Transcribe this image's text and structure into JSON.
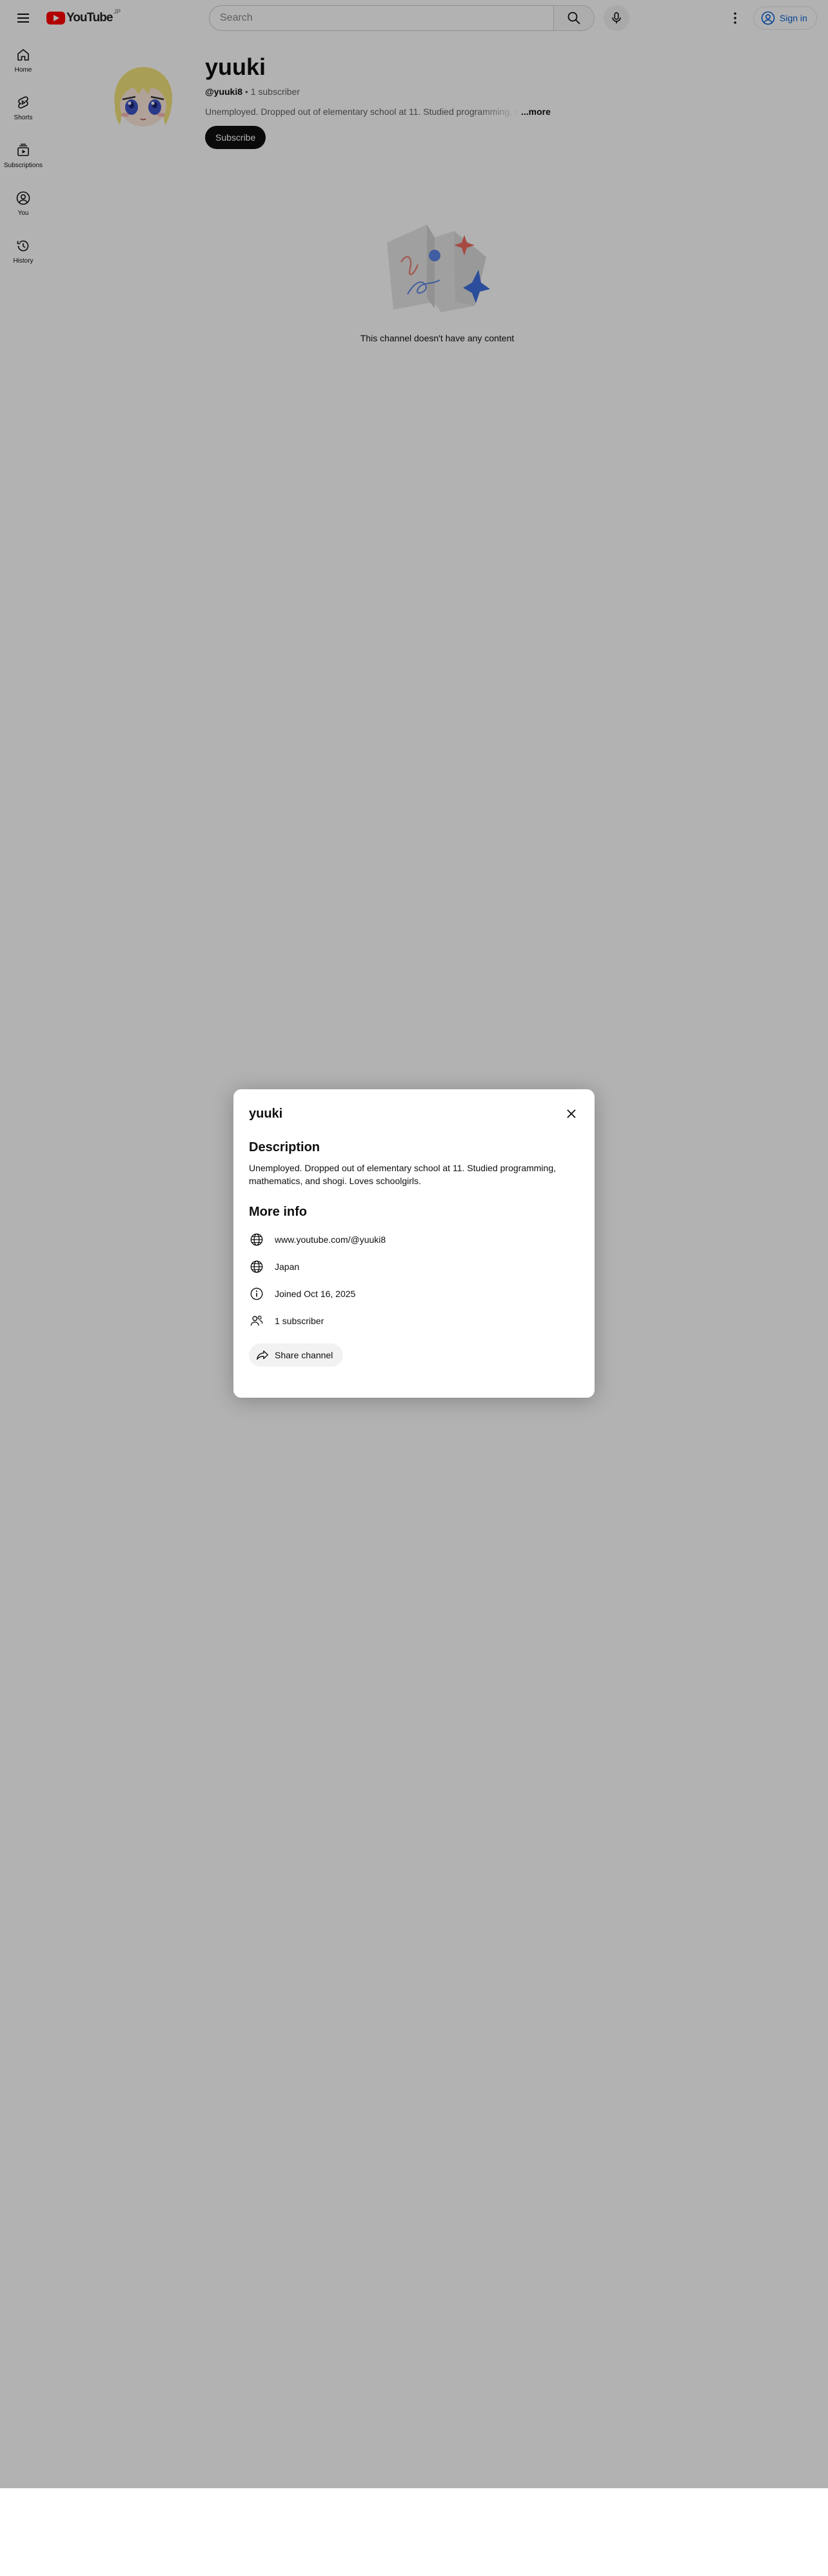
{
  "masthead": {
    "logo_text": "YouTube",
    "logo_country": "JP",
    "search_placeholder": "Search",
    "sign_in_label": "Sign in"
  },
  "guide": {
    "items": [
      {
        "label": "Home",
        "icon": "home-icon"
      },
      {
        "label": "Shorts",
        "icon": "shorts-icon"
      },
      {
        "label": "Subscriptions",
        "icon": "subscriptions-icon"
      },
      {
        "label": "You",
        "icon": "you-icon"
      },
      {
        "label": "History",
        "icon": "history-icon"
      }
    ]
  },
  "channel": {
    "name": "yuuki",
    "handle": "@yuuki8",
    "separator": " • ",
    "subscribers": "1 subscriber",
    "description_truncated": "Unemployed. Dropped out of elementary school at 11. Studied programming, mathematics,",
    "more_label": "...more",
    "subscribe_label": "Subscribe",
    "empty_message": "This channel doesn't have any content"
  },
  "about_dialog": {
    "title": "yuuki",
    "description_heading": "Description",
    "description": "Unemployed. Dropped out of elementary school at 11. Studied programming, mathematics, and shogi. Loves schoolgirls.",
    "more_info_heading": "More info",
    "rows": [
      {
        "icon": "globe-icon",
        "text": "www.youtube.com/@yuuki8"
      },
      {
        "icon": "globe-icon",
        "text": "Japan"
      },
      {
        "icon": "info-icon",
        "text": "Joined Oct 16, 2025"
      },
      {
        "icon": "people-icon",
        "text": "1 subscriber"
      }
    ],
    "share_label": "Share channel"
  },
  "colors": {
    "brand_red": "#ff0000",
    "link_blue": "#065fd4",
    "scrim": "rgba(0,0,0,0.30)"
  }
}
